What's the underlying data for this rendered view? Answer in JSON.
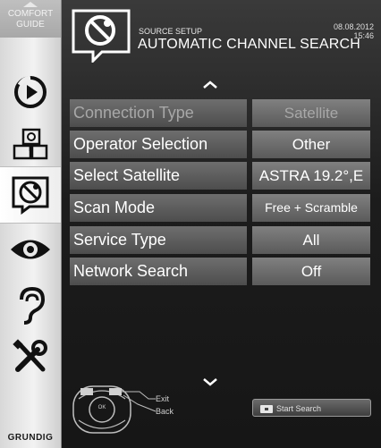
{
  "sidebar": {
    "comfort_guide": "COMFORT\nGUIDE",
    "comfort_line1": "COMFORT",
    "comfort_line2": "GUIDE",
    "brand": "GRUNDIG",
    "items": [
      {
        "icon": "playback-icon"
      },
      {
        "icon": "source-connection-icon"
      },
      {
        "icon": "satellite-dish-icon",
        "active": true
      },
      {
        "icon": "eye-icon"
      },
      {
        "icon": "ear-icon"
      },
      {
        "icon": "tools-icon"
      }
    ]
  },
  "header": {
    "section": "SOURCE SETUP",
    "title": "AUTOMATIC CHANNEL SEARCH",
    "date": "08.08.2012",
    "time": "15:46"
  },
  "settings": [
    {
      "label": "Connection Type",
      "value": "Satellite",
      "disabled": true
    },
    {
      "label": "Operator Selection",
      "value": "Other"
    },
    {
      "label": "Select Satellite",
      "value": "ASTRA 19.2°,E"
    },
    {
      "label": "Scan Mode",
      "value": "Free + Scramble"
    },
    {
      "label": "Service Type",
      "value": "All"
    },
    {
      "label": "Network Search",
      "value": "Off"
    }
  ],
  "footer": {
    "exit": "Exit",
    "back": "Back",
    "ok": "OK",
    "start_search": "Start Search"
  },
  "colors": {
    "background": "#1c1c1c",
    "row_label": "#5a5a5a",
    "row_value": "#6a6a6a",
    "sidebar": "#e6e6e6"
  }
}
